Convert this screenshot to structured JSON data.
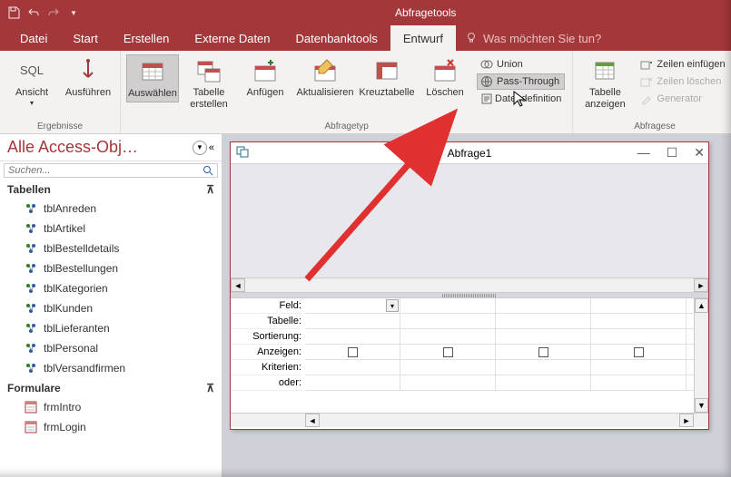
{
  "titlebar": {
    "context_tab": "Abfragetools"
  },
  "tabs": {
    "file": "Datei",
    "home": "Start",
    "create": "Erstellen",
    "external": "Externe Daten",
    "dbtools": "Datenbanktools",
    "design": "Entwurf",
    "tell_me": "Was möchten Sie tun?"
  },
  "ribbon": {
    "view": "Ansicht",
    "run": "Ausführen",
    "group_results": "Ergebnisse",
    "select": "Auswählen",
    "maketable": "Tabelle erstellen",
    "append": "Anfügen",
    "update": "Aktualisieren",
    "crosstab": "Kreuztabelle",
    "delete": "Löschen",
    "union": "Union",
    "passthrough": "Pass-Through",
    "datadef": "Datendefinition",
    "group_querytype": "Abfragetyp",
    "showtable": "Tabelle anzeigen",
    "insrows": "Zeilen einfügen",
    "delrows": "Zeilen löschen",
    "builder": "Generator",
    "group_setup": "Abfragese",
    "sql": "SQL"
  },
  "nav": {
    "title": "Alle Access-Obj…",
    "search_placeholder": "Suchen...",
    "cat_tables": "Tabellen",
    "cat_forms": "Formulare",
    "tables": [
      "tblAnreden",
      "tblArtikel",
      "tblBestelldetails",
      "tblBestellungen",
      "tblKategorien",
      "tblKunden",
      "tblLieferanten",
      "tblPersonal",
      "tblVersandfirmen"
    ],
    "forms": [
      "frmIntro",
      "frmLogin"
    ]
  },
  "query_window": {
    "title": "Abfrage1",
    "rows": {
      "field": "Feld:",
      "table": "Tabelle:",
      "sort": "Sortierung:",
      "show": "Anzeigen:",
      "criteria": "Kriterien:",
      "or": "oder:"
    }
  }
}
